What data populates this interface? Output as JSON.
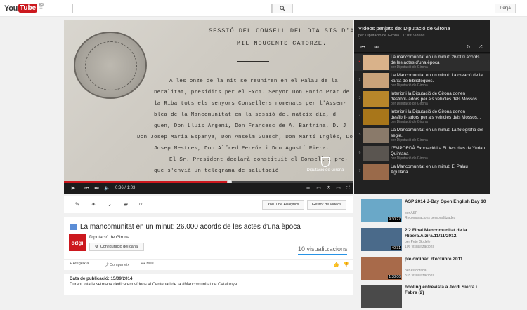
{
  "masthead": {
    "logo_you": "You",
    "logo_tube": "Tube",
    "logo_region": "ES",
    "search_placeholder": "",
    "signin_label": "Penja"
  },
  "player": {
    "document_lines": [
      "SESSIÓ DEL CONSELL DEL DIA SIS D'ABRIL DE",
      "MIL NOUCENTS CATORZE.",
      "A les onze de la nit se reuniren en el Palau de la",
      "neralitat, presidits per el Excm. Senyor Don Enric Prat de",
      "la Riba tots els senyors Consellers nomenats per l'Assem-",
      "blea de la Mancomunitat en la sessió del mateix dia, d",
      "guen, Don Lluis Argemí, Don Francesc de A. Bartrina, D. J",
      "Don Josep Maria Espanya, Don Anselm Guasch, Don Martí Inglés, Don",
      "Josep Mestres, Don Alfred Pereña i Don Agustí Riera.",
      "El Sr. President declarà constituit el Consell i pro-",
      "que s'envià un telegrama de salutació"
    ],
    "watermark": "Diputació de Girona",
    "time_current": "0:36",
    "time_total": "1:03",
    "progress": 0.57
  },
  "playlist": {
    "title": "Vídeos penjats de: Diputació de Girona",
    "subtitle": "per Diputació de Girona · 1/166 vídeos",
    "items": [
      {
        "num": "▸",
        "title": "La mancomunitat en un minut: 26.000 acords de les actes d'una època",
        "by": "per Diputació de Girona",
        "thumb": "#d9b28a"
      },
      {
        "num": "2",
        "title": "La Mancomunitat en un minut: La creació de la xarxa de biblioteques.",
        "by": "per Diputació de Girona",
        "thumb": "#c9a27a"
      },
      {
        "num": "3",
        "title": "Interior i la Diputació de Girona donen desfibril·ladors per als vehicles dels Mossos...",
        "by": "per Diputació de Girona",
        "thumb": "#b8862a"
      },
      {
        "num": "4",
        "title": "Interior i la Diputació de Girona donen desfibril·ladors per als vehicles dels Mossos...",
        "by": "per Diputació de Girona",
        "thumb": "#a8761a"
      },
      {
        "num": "5",
        "title": "La Mancomunitat en un minut: La fotografia del segle.",
        "by": "per Diputació de Girona",
        "thumb": "#8a7a6a"
      },
      {
        "num": "6",
        "title": "!'EMPORDÀ Exposició La Fi dels dies de Yurian Quintana",
        "by": "per Diputació de Girona",
        "thumb": "#5a5550"
      },
      {
        "num": "7",
        "title": "La Mancomunitat en un minut: El Palau Agullana",
        "by": "",
        "thumb": "#9a6a4a"
      }
    ]
  },
  "actions": {
    "analytics_label": "YouTube Analytics",
    "manager_label": "Gestor de vídeos"
  },
  "video": {
    "title": "La mancomunitat en un minut: 26.000 acords de les actes d'una època",
    "channel": "Diputació de Girona",
    "channel_settings": "Configuració del canal",
    "avatar_text": "ddgi",
    "views": "10 visualitzacions",
    "add_to": "Afegeix a...",
    "share": "Comparteix",
    "more": "Més",
    "published": "Data de publicació: 15/09/2014",
    "description": "Durant tota la setmana dedicarem vídeos al Centenari de la #Mancomunitat de Catalunya."
  },
  "related": [
    {
      "title": "ASP 2014 J-Bay Open English Day 10",
      "meta1": "per ASP",
      "meta2": "Recomanacions personalitzades",
      "duration": "9:30:27",
      "thumb": "#6aa8c8"
    },
    {
      "title": "2/2.Final.Mancomunitat de la Ribera.Alzira.11/11/2012.",
      "meta1": "per Pete Godele",
      "meta2": "106 visualitzacions",
      "duration": "40:31",
      "thumb": "#4a6a8a"
    },
    {
      "title": "ple ordinari d'octubre 2011",
      "meta1": "per estocrada",
      "meta2": "335 visualitzacions",
      "duration": "1:38:06",
      "thumb": "#a86a4a"
    },
    {
      "title": "booling entrevista a Jordi Sierra i Fabra (2)",
      "meta1": "",
      "meta2": "",
      "duration": "",
      "thumb": "#4a4a4a"
    }
  ],
  "colors": {
    "brand_red": "#cc181e",
    "link_blue": "#2793e6"
  }
}
